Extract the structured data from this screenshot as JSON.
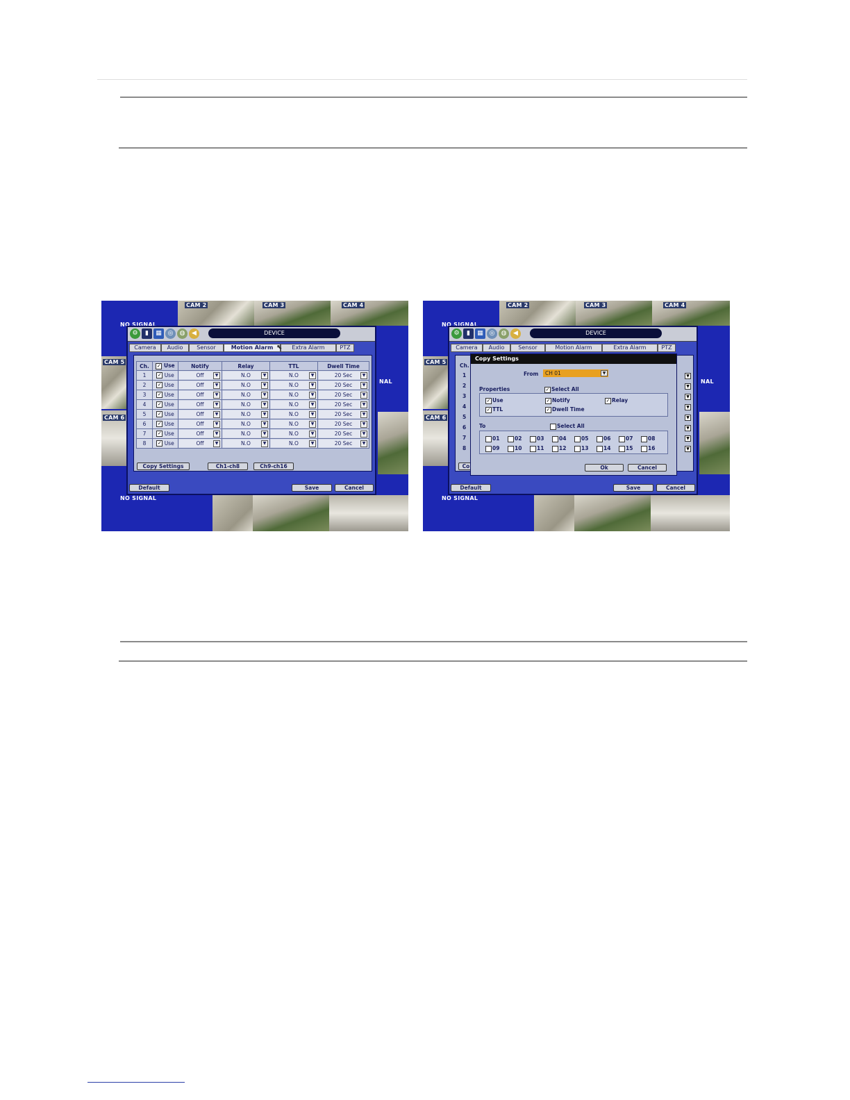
{
  "left_screenshot": {
    "camera_labels": [
      "CAM 2",
      "CAM 3",
      "CAM 4",
      "CAM 5",
      "CAM 6"
    ],
    "no_signal": "NO SIGNAL",
    "side_text": "NAL",
    "dialog_title": "DEVICE",
    "tabs": [
      "Camera",
      "Audio",
      "Sensor",
      "Motion Alarm",
      "Extra Alarm",
      "PTZ"
    ],
    "active_tab": "Motion Alarm",
    "columns": [
      "Ch.",
      "Use",
      "Notify",
      "Relay",
      "TTL",
      "Dwell Time"
    ],
    "rows": [
      {
        "ch": "1",
        "use": "Use",
        "notify": "Off",
        "relay": "N.O",
        "ttl": "N.O",
        "dwell": "20 Sec"
      },
      {
        "ch": "2",
        "use": "Use",
        "notify": "Off",
        "relay": "N.O",
        "ttl": "N.O",
        "dwell": "20 Sec"
      },
      {
        "ch": "3",
        "use": "Use",
        "notify": "Off",
        "relay": "N.O",
        "ttl": "N.O",
        "dwell": "20 Sec"
      },
      {
        "ch": "4",
        "use": "Use",
        "notify": "Off",
        "relay": "N.O",
        "ttl": "N.O",
        "dwell": "20 Sec"
      },
      {
        "ch": "5",
        "use": "Use",
        "notify": "Off",
        "relay": "N.O",
        "ttl": "N.O",
        "dwell": "20 Sec"
      },
      {
        "ch": "6",
        "use": "Use",
        "notify": "Off",
        "relay": "N.O",
        "ttl": "N.O",
        "dwell": "20 Sec"
      },
      {
        "ch": "7",
        "use": "Use",
        "notify": "Off",
        "relay": "N.O",
        "ttl": "N.O",
        "dwell": "20 Sec"
      },
      {
        "ch": "8",
        "use": "Use",
        "notify": "Off",
        "relay": "N.O",
        "ttl": "N.O",
        "dwell": "20 Sec"
      }
    ],
    "copy_settings_button": "Copy Settings",
    "page1_button": "Ch1-ch8",
    "page2_button": "Ch9-ch16",
    "default_button": "Default",
    "save_button": "Save",
    "cancel_button": "Cancel"
  },
  "right_screenshot": {
    "camera_labels": [
      "CAM 2",
      "CAM 3",
      "CAM 4",
      "CAM 5",
      "CAM 6"
    ],
    "no_signal": "NO SIGNAL",
    "side_text": "NAL",
    "dialog_title": "DEVICE",
    "tabs": [
      "Camera",
      "Audio",
      "Sensor",
      "Motion Alarm",
      "Extra Alarm",
      "PTZ"
    ],
    "peek_ch_header": "Ch.",
    "peek_rows": [
      "1",
      "2",
      "3",
      "4",
      "5",
      "6",
      "7",
      "8"
    ],
    "peek_copy_button": "Co",
    "modal": {
      "title": "Copy Settings",
      "from_label": "From",
      "from_value": "CH 01",
      "properties_label": "Properties",
      "select_all_label": "Select All",
      "properties": [
        {
          "label": "Use",
          "checked": true
        },
        {
          "label": "Notify",
          "checked": true
        },
        {
          "label": "Relay",
          "checked": true
        },
        {
          "label": "TTL",
          "checked": true
        },
        {
          "label": "Dwell Time",
          "checked": true
        }
      ],
      "to_label": "To",
      "to_select_all_label": "Select All",
      "channels": [
        "01",
        "02",
        "03",
        "04",
        "05",
        "06",
        "07",
        "08",
        "09",
        "10",
        "11",
        "12",
        "13",
        "14",
        "15",
        "16"
      ],
      "ok_button": "Ok",
      "cancel_button": "Cancel"
    },
    "default_button": "Default",
    "save_button": "Save",
    "cancel_button": "Cancel"
  }
}
